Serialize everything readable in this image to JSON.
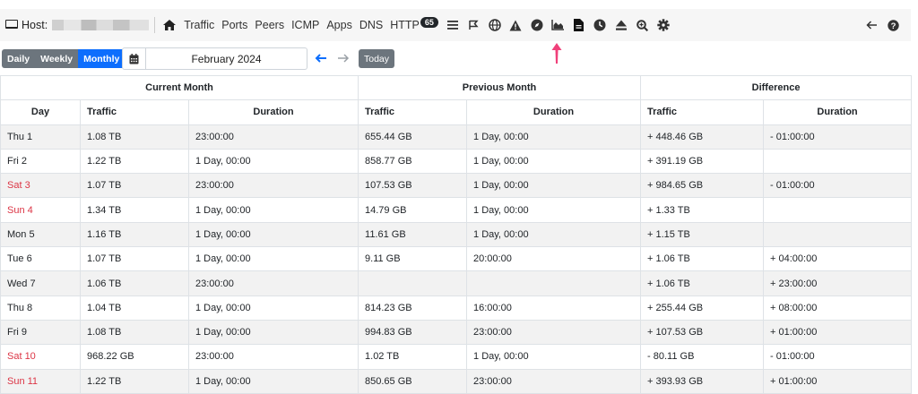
{
  "nav": {
    "host_label": "Host:",
    "links": [
      "Traffic",
      "Ports",
      "Peers",
      "ICMP",
      "Apps",
      "DNS",
      "HTTP"
    ],
    "http_badge": "65",
    "icons": [
      "bars-icon",
      "flag-icon",
      "globe-icon",
      "warning-icon",
      "compass-icon",
      "area-chart-icon",
      "file-icon",
      "clock-icon",
      "eject-icon",
      "search-plus-icon",
      "gear-icon"
    ],
    "right_icons": [
      "back-arrow-icon",
      "help-icon"
    ],
    "annotation_color": "#f0407a"
  },
  "toolbar": {
    "periods": [
      "Daily",
      "Weekly",
      "Monthly"
    ],
    "active_period": "Monthly",
    "date_value": "February 2024",
    "prev_arrow": "🡐",
    "next_arrow": "🡒",
    "today_label": "Today"
  },
  "table": {
    "groups": [
      "Current Month",
      "Previous Month",
      "Difference"
    ],
    "columns": [
      "Day",
      "Traffic",
      "Duration",
      "Traffic",
      "Duration",
      "Traffic",
      "Duration"
    ],
    "rows": [
      {
        "day": "Thu 1",
        "weekend": false,
        "cur_traffic": "1.08 TB",
        "cur_duration": "23:00:00",
        "prev_traffic": "655.44 GB",
        "prev_duration": "1 Day, 00:00",
        "diff_traffic": "+ 448.46 GB",
        "diff_duration": "- 01:00:00"
      },
      {
        "day": "Fri 2",
        "weekend": false,
        "cur_traffic": "1.22 TB",
        "cur_duration": "1 Day, 00:00",
        "prev_traffic": "858.77 GB",
        "prev_duration": "1 Day, 00:00",
        "diff_traffic": "+ 391.19 GB",
        "diff_duration": ""
      },
      {
        "day": "Sat 3",
        "weekend": true,
        "cur_traffic": "1.07 TB",
        "cur_duration": "23:00:00",
        "prev_traffic": "107.53 GB",
        "prev_duration": "1 Day, 00:00",
        "diff_traffic": "+ 984.65 GB",
        "diff_duration": "- 01:00:00"
      },
      {
        "day": "Sun 4",
        "weekend": true,
        "cur_traffic": "1.34 TB",
        "cur_duration": "1 Day, 00:00",
        "prev_traffic": "14.79 GB",
        "prev_duration": "1 Day, 00:00",
        "diff_traffic": "+ 1.33 TB",
        "diff_duration": ""
      },
      {
        "day": "Mon 5",
        "weekend": false,
        "cur_traffic": "1.16 TB",
        "cur_duration": "1 Day, 00:00",
        "prev_traffic": "11.61 GB",
        "prev_duration": "1 Day, 00:00",
        "diff_traffic": "+ 1.15 TB",
        "diff_duration": ""
      },
      {
        "day": "Tue 6",
        "weekend": false,
        "cur_traffic": "1.07 TB",
        "cur_duration": "1 Day, 00:00",
        "prev_traffic": "9.11 GB",
        "prev_duration": "20:00:00",
        "diff_traffic": "+ 1.06 TB",
        "diff_duration": "+ 04:00:00"
      },
      {
        "day": "Wed 7",
        "weekend": false,
        "cur_traffic": "1.06 TB",
        "cur_duration": "23:00:00",
        "prev_traffic": "",
        "prev_duration": "",
        "diff_traffic": "+ 1.06 TB",
        "diff_duration": "+ 23:00:00"
      },
      {
        "day": "Thu 8",
        "weekend": false,
        "cur_traffic": "1.04 TB",
        "cur_duration": "1 Day, 00:00",
        "prev_traffic": "814.23 GB",
        "prev_duration": "16:00:00",
        "diff_traffic": "+ 255.44 GB",
        "diff_duration": "+ 08:00:00"
      },
      {
        "day": "Fri 9",
        "weekend": false,
        "cur_traffic": "1.08 TB",
        "cur_duration": "1 Day, 00:00",
        "prev_traffic": "994.83 GB",
        "prev_duration": "23:00:00",
        "diff_traffic": "+ 107.53 GB",
        "diff_duration": "+ 01:00:00"
      },
      {
        "day": "Sat 10",
        "weekend": true,
        "cur_traffic": "968.22 GB",
        "cur_duration": "23:00:00",
        "prev_traffic": "1.02 TB",
        "prev_duration": "1 Day, 00:00",
        "diff_traffic": "- 80.11 GB",
        "diff_duration": "- 01:00:00"
      },
      {
        "day": "Sun 11",
        "weekend": true,
        "cur_traffic": "1.22 TB",
        "cur_duration": "1 Day, 00:00",
        "prev_traffic": "850.65 GB",
        "prev_duration": "23:00:00",
        "diff_traffic": "+ 393.93 GB",
        "diff_duration": "+ 01:00:00"
      }
    ]
  }
}
